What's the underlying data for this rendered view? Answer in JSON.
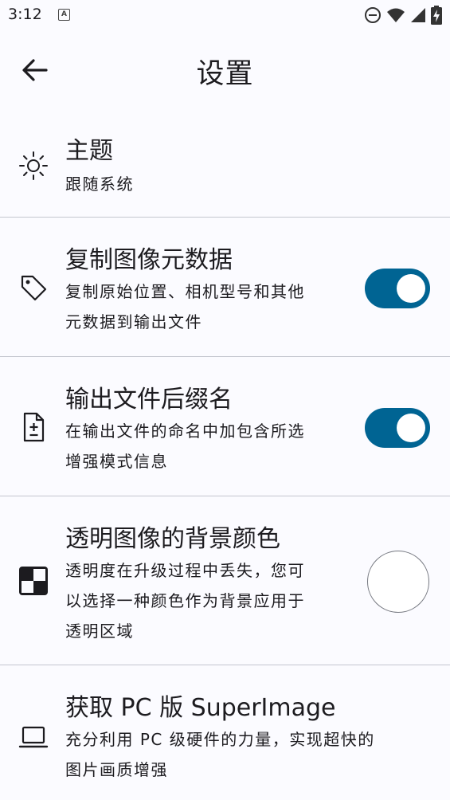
{
  "status_bar": {
    "time": "3:12",
    "notif_badge": "A"
  },
  "top_bar": {
    "title": "设置"
  },
  "settings": {
    "theme": {
      "title": "主题",
      "subtitle": "跟随系统"
    },
    "metadata": {
      "title": "复制图像元数据",
      "line1": "复制原始位置、相机型号和其他",
      "line2": "元数据到输出文件",
      "enabled": true
    },
    "suffix": {
      "title": "输出文件后缀名",
      "line1": "在输出文件的命名中加包含所选",
      "line2": "增强模式信息",
      "enabled": true
    },
    "background": {
      "title": "透明图像的背景颜色",
      "line1": "透明度在升级过程中丢失，您可",
      "line2": "以选择一种颜色作为背景应用于",
      "line3": "透明区域",
      "color": "#ffffff"
    },
    "pc": {
      "title": "获取 PC 版 SuperImage",
      "line1": "充分利用 PC 级硬件的力量，实现超快的",
      "line2": "图片画质增强"
    }
  },
  "colors": {
    "accent": "#006493",
    "background": "#fbfbff",
    "divider": "#c4c6cf"
  }
}
